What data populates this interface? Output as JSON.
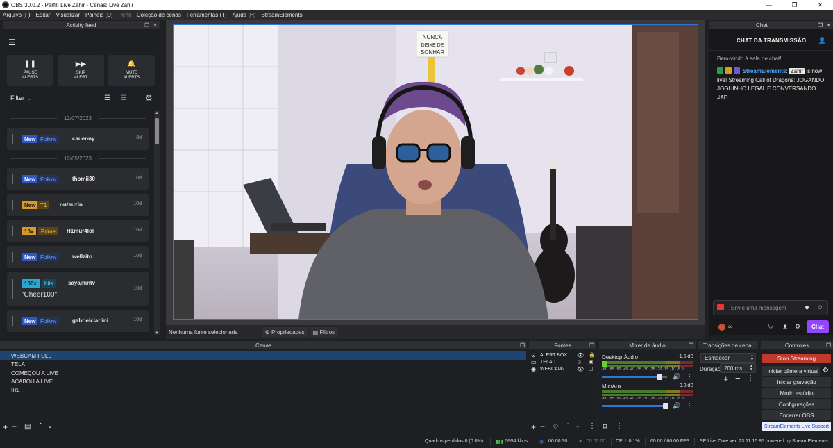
{
  "window": {
    "title": "OBS 30.0.2 - Perfil: Live Zahir - Cenas: Live Zahir",
    "controls": [
      "—",
      "❐",
      "✕"
    ]
  },
  "menu": [
    "Arquivo (F)",
    "Editar",
    "Visualizar",
    "Painéis (D)",
    "Perfil",
    "Coleção de cenas",
    "Ferramentas (T)",
    "Ajuda (H)",
    "StreamElements"
  ],
  "activity_feed": {
    "title": "Activity feed",
    "buttons": [
      {
        "icon": "❚❚",
        "label": "PAUSE\nALERTS"
      },
      {
        "icon": "▶▶",
        "label": "SKIP\nALERT"
      },
      {
        "icon": "🔔",
        "label": "MUTE\nALERTS"
      }
    ],
    "filter_label": "Filter",
    "date1": "12/07/2023",
    "date2": "12/05/2023",
    "events": [
      {
        "b1": "New",
        "b2": "Follow",
        "user": "cauenny",
        "age": "8d"
      },
      {
        "b1": "New",
        "b2": "Follow",
        "user": "thomii30",
        "age": "10d"
      },
      {
        "b1": "New",
        "b2": "T1",
        "user": "nutsuzin",
        "age": "10d"
      },
      {
        "b1": "10x",
        "b2": "Prime",
        "user": "H1mur4lol",
        "age": "10d"
      },
      {
        "b1": "New",
        "b2": "Follow",
        "user": "wellzito",
        "age": "10d"
      },
      {
        "b1": "100x",
        "b2": "bits",
        "user": "sayajhintv",
        "age": "10d",
        "msg": "\"Cheer100\""
      },
      {
        "b1": "New",
        "b2": "Follow",
        "user": "gabrielciarlini",
        "age": "10d"
      }
    ]
  },
  "preview": {
    "sign_line1": "NUNCA",
    "sign_line2": "DEIXE DE",
    "sign_line3": "SONHAR",
    "no_source": "Nenhuma fonte selecionada",
    "properties": "Propriedades",
    "filters": "Filtros"
  },
  "chat": {
    "dock_title": "Chat",
    "title": "CHAT DA TRANSMISSÃO",
    "welcome": "Bem-vindo à sala de chat!",
    "sender": "StreamElements",
    "mention": "Zahir",
    "message": " is now live! Streaming Call of Dragons: JOGANDO JOGUINHO LEGAL E CONVERSANDO #AD",
    "input_placeholder": "Envie uma mensagem",
    "infinity": "∞",
    "chat_button": "Chat"
  },
  "docks": {
    "scenes": "Cenas",
    "sources": "Fontes",
    "mixer": "Mixer de áudio",
    "transitions": "Transições de cena",
    "controls": "Controles"
  },
  "scenes": [
    "WEBCAM FULL",
    "TELA",
    "COMEÇOU A LIVE",
    "ACABOU A LIVE",
    "IRL"
  ],
  "sources": [
    {
      "icon": "⊙",
      "name": "ALERT BOX"
    },
    {
      "icon": "▭",
      "name": "TELA 1"
    },
    {
      "icon": "◉",
      "name": "WEBCAM2"
    }
  ],
  "mixer": [
    {
      "name": "Desktop Áudio",
      "db": "-1.5 dB",
      "level": 0.05,
      "volume": 0.88
    },
    {
      "name": "Mic/Aux",
      "db": "0.0 dB",
      "level": 0.0,
      "volume": 0.98
    }
  ],
  "mixer_scale": "-60 -55 -50 -45 -40 -35 -30 -25 -20 -15 -10 -5 0",
  "transitions": {
    "type": "Esmaecer",
    "duration_label": "Duração",
    "duration": "200 ms"
  },
  "controls": [
    "Stop Streaming",
    "Iniciar câmera virtual",
    "Iniciar gravação",
    "Modo estúdio",
    "Configurações",
    "Encerrar OBS",
    "StreamElements Live Support"
  ],
  "status": {
    "dropped": "Quadros perdidos 0 (0.0%)",
    "bitrate": "5954 kbps",
    "stream_time": "00:00:30",
    "rec_time": "00:00:00",
    "cpu": "CPU: 0.1%",
    "fps": "60.00 / 60.00 FPS",
    "se_version": "SE.Live Core ver. 23.11.15.85 powered by StreamElements"
  },
  "colors": {
    "accent": "#2d78d7",
    "twitch": "#9147ff",
    "stop_streaming": "#c0392b",
    "activity_bg": "#1e1f22"
  }
}
